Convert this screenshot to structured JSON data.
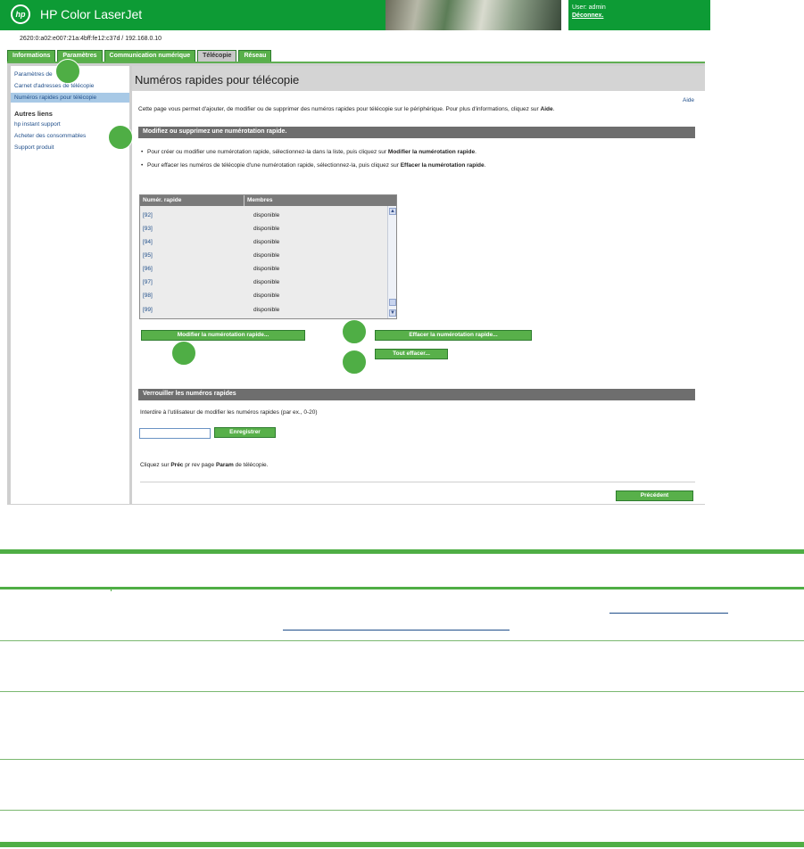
{
  "header": {
    "logo_text": "hp",
    "product_name": "HP Color LaserJet",
    "user_label": "User: admin",
    "logout_label": "Déconnex."
  },
  "address": "2620:0:a02:e007:21a:4bff:fe12:c37d / 192.168.0.10",
  "tabs": [
    {
      "label": "Informations"
    },
    {
      "label": "Paramètres"
    },
    {
      "label": "Communication numérique"
    },
    {
      "label": "Télécopie"
    },
    {
      "label": "Réseau"
    }
  ],
  "sidebar": {
    "items": [
      {
        "label": "Paramètres de"
      },
      {
        "label": "Carnet d'adresses de télécopie"
      },
      {
        "label": "Numéros rapides pour télécopie"
      }
    ],
    "other_heading": "Autres liens",
    "other_links": [
      {
        "label": "hp instant support"
      },
      {
        "label": "Acheter des consommables"
      },
      {
        "label": "Support produit"
      }
    ]
  },
  "main": {
    "page_title": "Numéros rapides pour télécopie",
    "help_link": "Aide",
    "intro_text": "Cette page vous permet d'ajouter, de modifier ou de supprimer des numéros rapides pour télécopie sur le périphérique. Pour plus d'informations, cliquez sur ",
    "intro_bold": "Aide",
    "intro_end": ".",
    "section_modify": "Modifiez ou supprimez une numérotation rapide.",
    "bullet1_text": "Pour créer ou modifier une numérotation rapide, sélectionnez-la dans la liste, puis cliquez sur ",
    "bullet1_bold": "Modifier la numérotation rapide",
    "bullet2_text": "Pour effacer les numéros de télécopie d'une numérotation rapide, sélectionnez-la, puis cliquez sur ",
    "bullet2_bold": "Effacer la numérotation rapide",
    "period": ".",
    "list": {
      "col_number": "Numér. rapide",
      "col_members": "Membres",
      "rows": [
        {
          "number": "[92]",
          "members": "disponible"
        },
        {
          "number": "[93]",
          "members": "disponible"
        },
        {
          "number": "[94]",
          "members": "disponible"
        },
        {
          "number": "[95]",
          "members": "disponible"
        },
        {
          "number": "[96]",
          "members": "disponible"
        },
        {
          "number": "[97]",
          "members": "disponible"
        },
        {
          "number": "[98]",
          "members": "disponible"
        },
        {
          "number": "[99]",
          "members": "disponible"
        }
      ]
    },
    "btn_modify": "Modifier la numérotation rapide...",
    "btn_clear": "Effacer la numérotation rapide...",
    "btn_clear_all": "Tout effacer...",
    "section_lock": "Verrouiller les numéros rapides",
    "lock_description": "Interdire à l'utilisateur de modifier les numéros rapides (par ex., 0-20)",
    "lock_value": "",
    "btn_save": "Enregistrer",
    "footer_prefix": "Cliquez sur ",
    "footer_bold1": "Préc",
    "footer_mid": " pr rev page ",
    "footer_bold2": "Param",
    "footer_suffix": " de télécopie.",
    "btn_previous": "Précédent"
  },
  "colors": {
    "hp_green": "#0d9b35",
    "tab_green": "#58b04a",
    "section_grey": "#6e6e6e",
    "link_blue": "#1f4e8a",
    "callout_green": "#4fae45"
  }
}
